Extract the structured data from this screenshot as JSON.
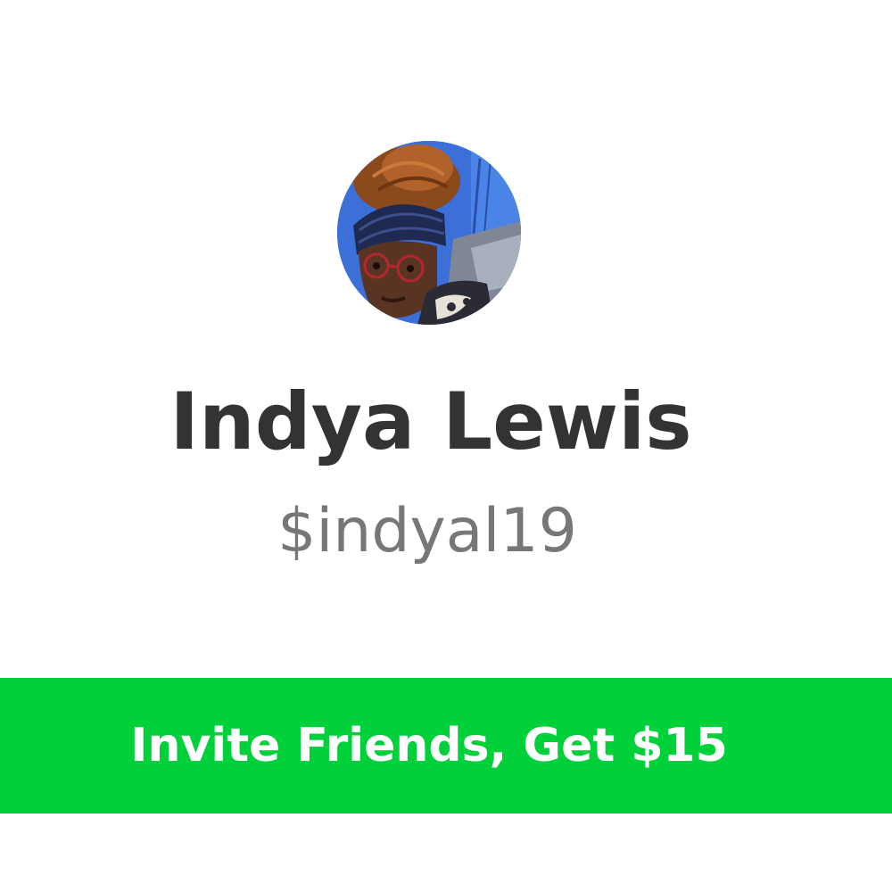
{
  "profile": {
    "name": "Indya Lewis",
    "cashtag": "$indyal19",
    "avatar_icon": "profile-photo"
  },
  "invite": {
    "label": "Invite Friends, Get $15"
  },
  "colors": {
    "accent": "#00d13b",
    "name_text": "#333333",
    "cashtag_text": "#777777",
    "background": "#ffffff"
  }
}
